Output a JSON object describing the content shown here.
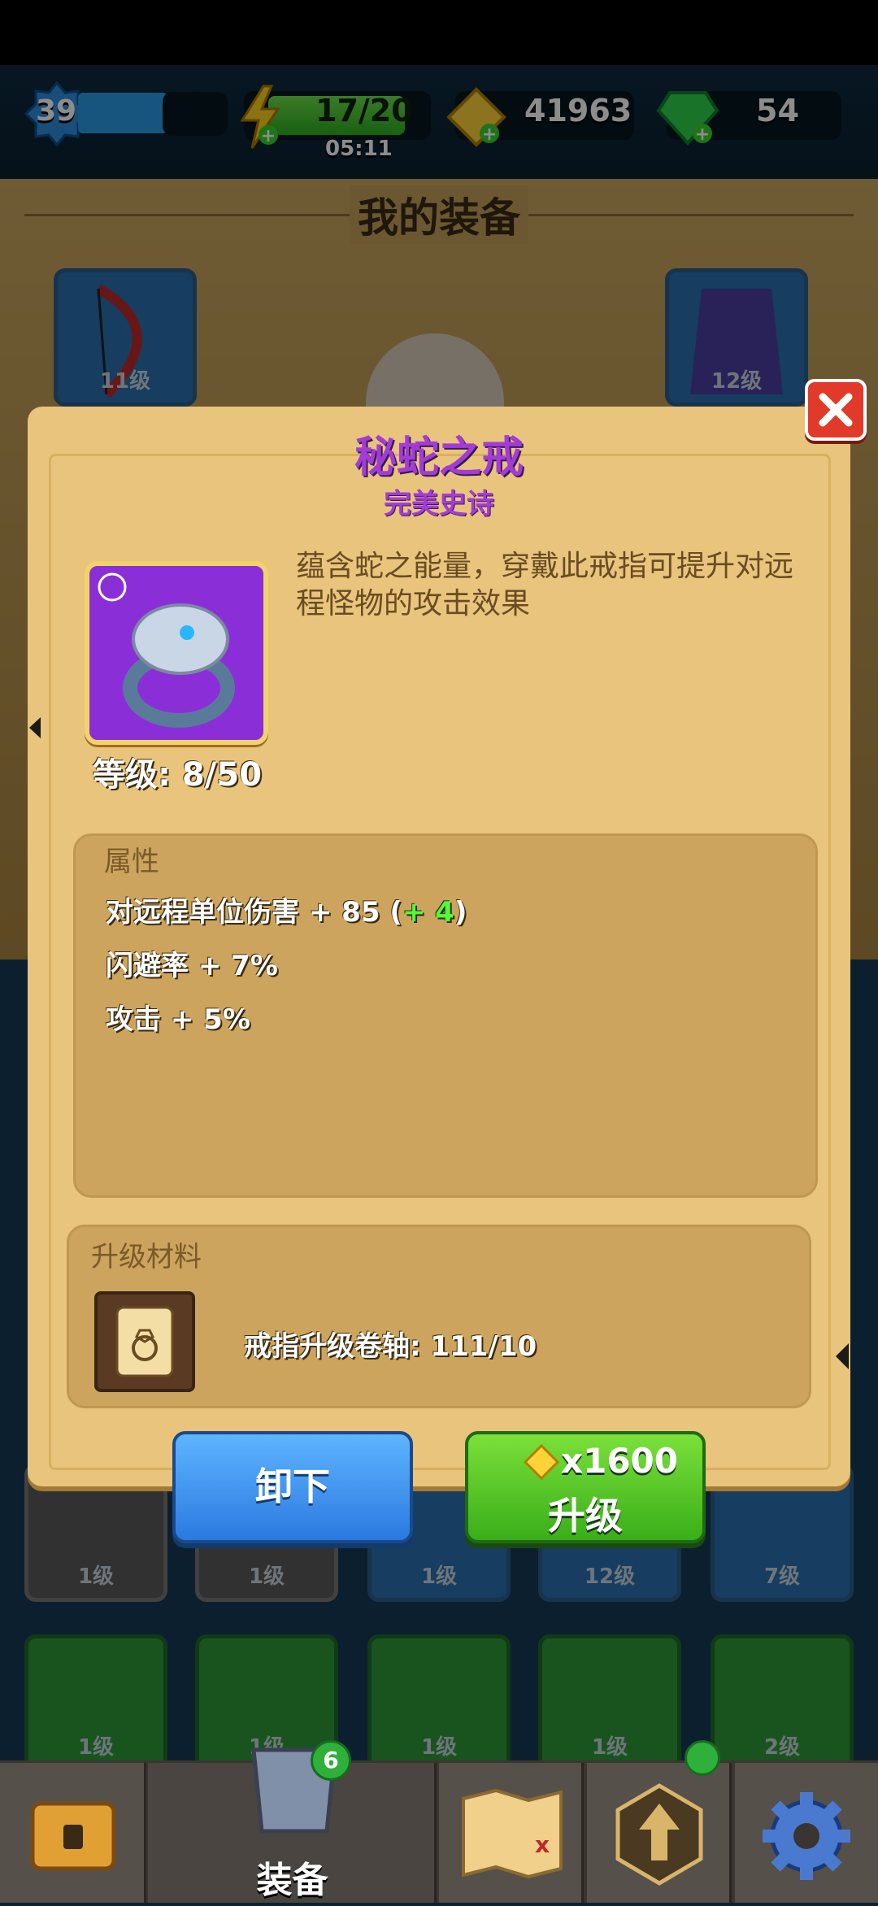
{
  "hud": {
    "level": "39",
    "energy": "17/20",
    "energy_timer": "05:11",
    "gold": "41963",
    "gems": "54"
  },
  "background": {
    "section_title": "我的装备",
    "top_cards": [
      {
        "level": "11级"
      },
      {
        "level": "12级"
      }
    ],
    "row1_cards": [
      {
        "level": "1级"
      },
      {
        "level": "1级"
      },
      {
        "level": "1级"
      },
      {
        "level": "12级"
      },
      {
        "level": "7级"
      }
    ],
    "row2_cards": [
      {
        "level": "1级"
      },
      {
        "level": "1级"
      },
      {
        "level": "1级"
      },
      {
        "level": "1级"
      },
      {
        "level": "2级"
      }
    ]
  },
  "dialog": {
    "item_name": "秘蛇之戒",
    "rarity": "完美史诗",
    "description": "蕴含蛇之能量，穿戴此戒指可提升对远程怪物的攻击效果",
    "level_label": "等级: 8/50",
    "attributes_title": "属性",
    "attributes": [
      {
        "prefix": "对远程单位伤害 + 85 (",
        "bonus": "+ 4",
        "suffix": ")"
      },
      {
        "prefix": "闪避率 + 7%",
        "bonus": "",
        "suffix": ""
      },
      {
        "prefix": "攻击 + 5%",
        "bonus": "",
        "suffix": ""
      }
    ],
    "materials_title": "升级材料",
    "material_label": "戒指升级卷轴: 111/10",
    "unequip_label": "卸下",
    "upgrade_cost": "x1600",
    "upgrade_label": "升级",
    "colors": {
      "title_purple": "#9a3bd6",
      "bonus_green": "#4cff3a",
      "card_purple": "#8a2fd8"
    }
  },
  "nav": {
    "equipment_label": "装备",
    "equipment_badge": "6"
  }
}
